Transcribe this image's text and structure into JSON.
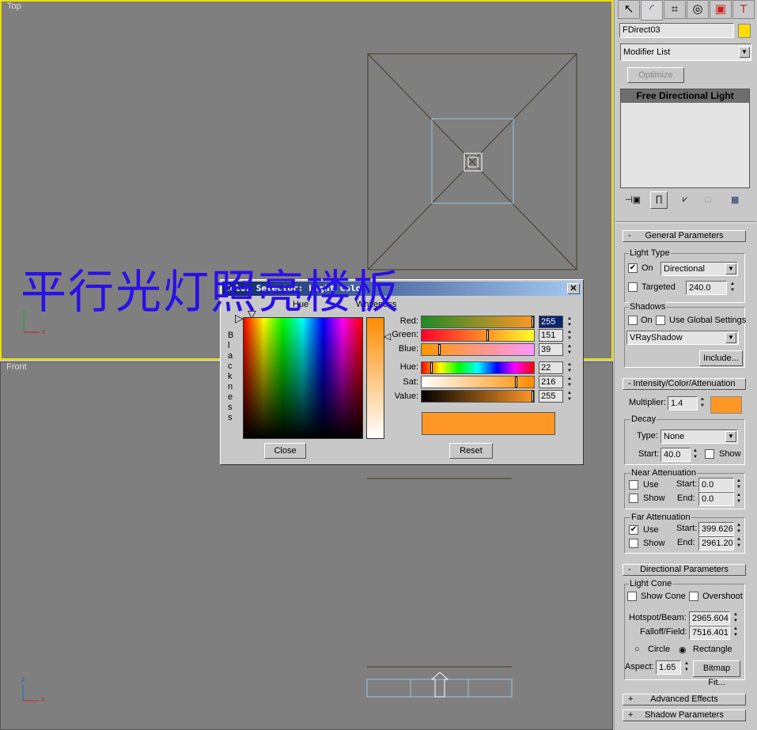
{
  "viewports": {
    "top_label": "Top",
    "front_label": "Front",
    "axis_x": "x",
    "axis_y": "y",
    "axis_z": "z"
  },
  "overlay_text": "平行光灯照亮楼板",
  "tabs": [
    "create-icon",
    "modify-icon",
    "hierarchy-icon",
    "motion-icon",
    "display-icon",
    "utilities-icon"
  ],
  "object": {
    "name": "FDirect03",
    "color": "#ffdd00"
  },
  "modifier_list": "Modifier List",
  "optimize_label": "Optimize",
  "stack_item": "Free Directional Light",
  "general": {
    "title": "General Parameters",
    "light_type": "Light Type",
    "on": "On",
    "type": "Directional",
    "targeted": "Targeted",
    "target_dist": "240.0",
    "shadows": "Shadows",
    "shadow_on": "On",
    "use_global": "Use Global Settings",
    "shadow_type": "VRayShadow",
    "include": "Include..."
  },
  "intensity": {
    "title": "Intensity/Color/Attenuation",
    "multiplier_label": "Multiplier:",
    "multiplier": "1.4",
    "color": "#ff9727",
    "decay": "Decay",
    "type_label": "Type:",
    "type": "None",
    "start_label": "Start:",
    "start": "40.0",
    "show": "Show",
    "near": "Near Attenuation",
    "use": "Use",
    "near_start": "0.0",
    "near_end": "0.0",
    "end_label": "End:",
    "far": "Far Attenuation",
    "far_start": "399.626",
    "far_end": "2961.20"
  },
  "directional": {
    "title": "Directional Parameters",
    "light_cone": "Light Cone",
    "show_cone": "Show Cone",
    "overshoot": "Overshoot",
    "hotspot_label": "Hotspot/Beam:",
    "hotspot": "2965.604",
    "falloff_label": "Falloff/Field:",
    "falloff": "7516.401",
    "circle": "Circle",
    "rectangle": "Rectangle",
    "aspect_label": "Aspect:",
    "aspect": "1.65",
    "bitmap_fit": "Bitmap Fit..."
  },
  "advanced": "Advanced Effects",
  "shadow_params": "Shadow Parameters",
  "dialog": {
    "title": "Color Selector: Light Color",
    "hue": "Hue",
    "whiteness": "Whiteness",
    "blackness": "Blackness",
    "red_label": "Red:",
    "red": "255",
    "green_label": "Green:",
    "green": "151",
    "blue_label": "Blue:",
    "blue": "39",
    "hue_label": "Hue:",
    "hue_val": "22",
    "sat_label": "Sat:",
    "sat": "216",
    "value_label": "Value:",
    "value": "255",
    "swatch": "#ff9727",
    "close": "Close",
    "reset": "Reset"
  }
}
